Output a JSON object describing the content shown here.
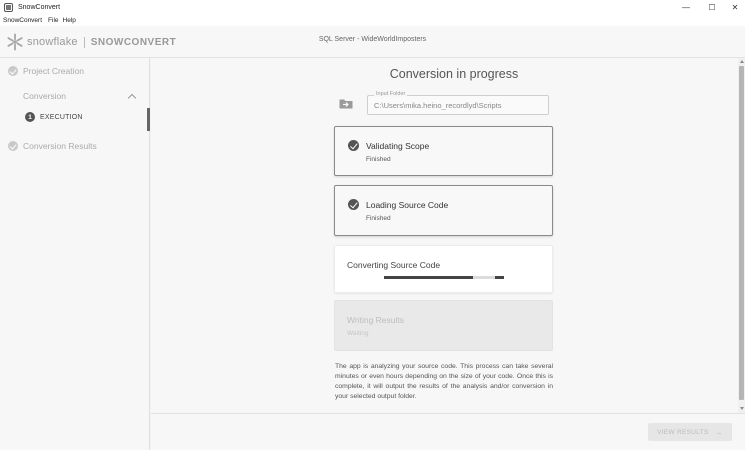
{
  "window": {
    "title": "SnowConvert",
    "controls": {
      "minimize": "—",
      "maximize": "☐",
      "close": "✕"
    }
  },
  "menu": [
    "SnowConvert",
    "File",
    "Help"
  ],
  "header": {
    "brand": "snowflake",
    "product": "SNOWCONVERT",
    "project": "SQL Server - WideWorldImposters"
  },
  "sidebar": {
    "steps": [
      {
        "label": "Project Creation",
        "state": "completed"
      },
      {
        "label": "Conversion",
        "state": "expanded"
      },
      {
        "label": "Conversion Results",
        "state": "completed"
      }
    ],
    "substep": {
      "number": "1",
      "label": "EXECUTION"
    }
  },
  "main": {
    "title": "Conversion in progress",
    "input_folder": {
      "label": "Input Folder",
      "value": "C:\\Users\\mika.heino_recordlyd\\Scripts"
    },
    "tasks": [
      {
        "title": "Validating Scope",
        "status": "Finished",
        "state": "done"
      },
      {
        "title": "Loading Source Code",
        "status": "Finished",
        "state": "done"
      },
      {
        "title": "Converting Source Code",
        "status": "",
        "state": "active"
      },
      {
        "title": "Writing Results",
        "status": "Waiting",
        "state": "waiting"
      }
    ],
    "description": "The app is analyzing your source code. This process can take several minutes or even hours depending on the size of your code. Once this is complete, it will output the results of the analysis and/or conversion in your selected output folder."
  },
  "footer": {
    "view_results": "VIEW RESULTS"
  },
  "colors": {
    "accent": "#555555",
    "disabled": "#bbbbbb",
    "background": "#f7f7f7"
  }
}
